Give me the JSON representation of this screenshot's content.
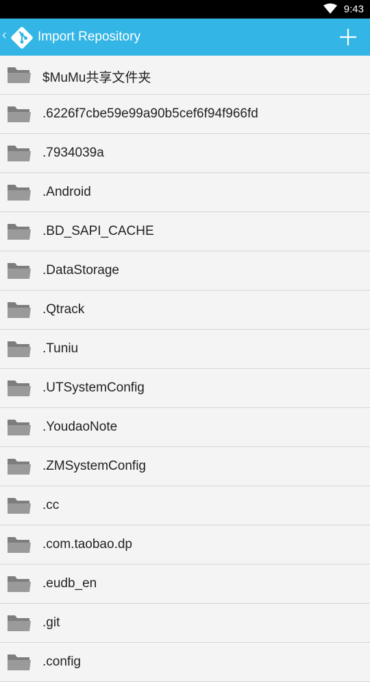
{
  "status_bar": {
    "time": "9:43",
    "wifi_icon": "wifi-icon"
  },
  "app_bar": {
    "title": "Import Repository",
    "back_icon": "chevron-left-icon",
    "logo_icon": "git-logo-icon",
    "add_icon": "plus-icon"
  },
  "folders": [
    "$MuMu共享文件夹",
    ".6226f7cbe59e99a90b5cef6f94f966fd",
    ".7934039a",
    ".Android",
    ".BD_SAPI_CACHE",
    ".DataStorage",
    ".Qtrack",
    ".Tuniu",
    ".UTSystemConfig",
    ".YoudaoNote",
    ".ZMSystemConfig",
    ".cc",
    ".com.taobao.dp",
    ".eudb_en",
    ".git",
    ".config"
  ],
  "colors": {
    "app_bar": "#33b5e5",
    "folder": "#8c8c8c",
    "status_bar": "#000000"
  }
}
